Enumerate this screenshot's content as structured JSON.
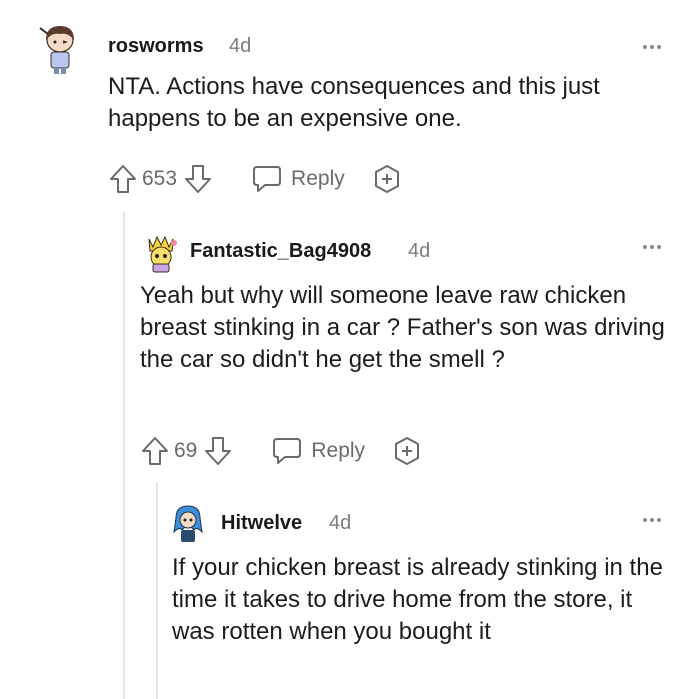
{
  "comments": [
    {
      "username": "rosworms",
      "age": "4d",
      "body": "NTA. Actions have consequences and this just happens to be an expensive one.",
      "votes": "653",
      "reply_label": "Reply"
    },
    {
      "username": "Fantastic_Bag4908",
      "age": "4d",
      "body": "Yeah but why will someone leave raw chicken breast stinking in a car ? Father's son was driving the car so didn't he get the smell ?",
      "votes": "69",
      "reply_label": "Reply"
    },
    {
      "username": "Hitwelve",
      "age": "4d",
      "body": "If your chicken breast is already stinking in the time it takes to drive home from the store, it was rotten when you bought it"
    }
  ],
  "icons": {
    "upvote": "upvote-arrow-icon",
    "downvote": "downvote-arrow-icon",
    "reply": "speech-bubble-icon",
    "award": "award-plus-icon",
    "more": "more-options-icon"
  },
  "colors": {
    "text": "#1c1c1c",
    "meta": "#7c7c7c",
    "icon": "#6a6a6a",
    "thread_line": "#e4e6e8"
  }
}
